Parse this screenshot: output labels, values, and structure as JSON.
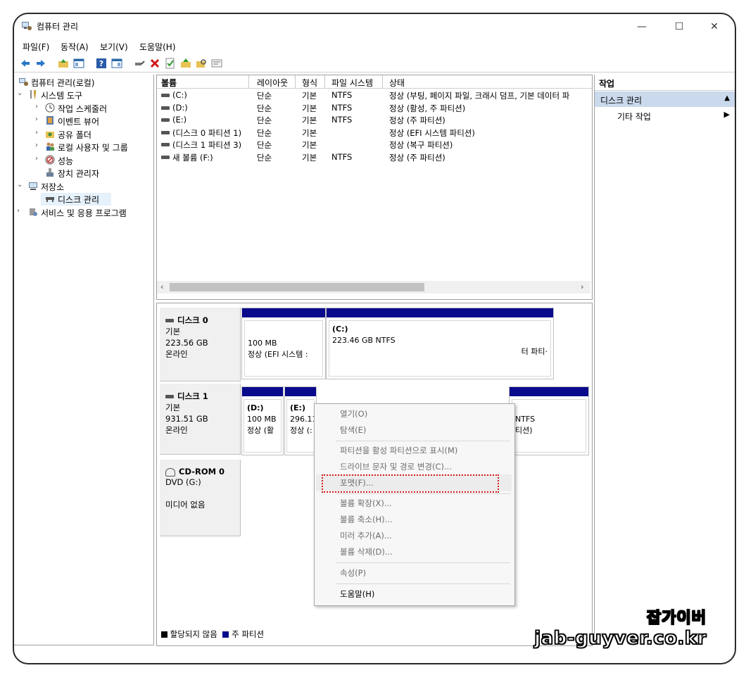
{
  "window": {
    "title": "컴퓨터 관리",
    "minimize": "—",
    "maximize": "☐",
    "close": "✕"
  },
  "menu": [
    "파일(F)",
    "동작(A)",
    "보기(V)",
    "도움말(H)"
  ],
  "tree": {
    "root": "컴퓨터 관리(로컬)",
    "system_tools": "시스템 도구",
    "task_scheduler": "작업 스케줄러",
    "event_viewer": "이벤트 뷰어",
    "shared_folders": "공유 폴더",
    "local_users": "로컬 사용자 및 그룹",
    "performance": "성능",
    "device_manager": "장치 관리자",
    "storage": "저장소",
    "disk_management": "디스크 관리",
    "services": "서비스 및 응용 프로그램"
  },
  "volume_table": {
    "headers": [
      "볼륨",
      "레이아웃",
      "형식",
      "파일 시스템",
      "상태"
    ],
    "rows": [
      [
        "(C:)",
        "단순",
        "기본",
        "NTFS",
        "정상 (부팅, 페이지 파일, 크래시 덤프, 기본 데이터 파"
      ],
      [
        "(D:)",
        "단순",
        "기본",
        "NTFS",
        "정상 (활성, 주 파티션)"
      ],
      [
        "(E:)",
        "단순",
        "기본",
        "NTFS",
        "정상 (주 파티션)"
      ],
      [
        "(디스크 0 파티션 1)",
        "단순",
        "기본",
        "",
        "정상 (EFI 시스템 파티션)"
      ],
      [
        "(디스크 1 파티션 3)",
        "단순",
        "기본",
        "",
        "정상 (복구 파티션)"
      ],
      [
        "새 볼륨 (F:)",
        "단순",
        "기본",
        "NTFS",
        "정상 (주 파티션)"
      ]
    ]
  },
  "disks": {
    "disk0": {
      "name": "디스크 0",
      "type": "기본",
      "size": "223.56 GB",
      "status": "온라인",
      "p1": {
        "size": "100 MB",
        "status": "정상 (EFI 시스템 :"
      },
      "p2": {
        "label": "(C:)",
        "size": "223.46 GB NTFS",
        "status": "터 파티·"
      }
    },
    "disk1": {
      "name": "디스크 1",
      "type": "기본",
      "size": "931.51 GB",
      "status": "온라인",
      "p1": {
        "label": "(D:)",
        "size": "100 MB",
        "status": "정상 (활"
      },
      "p2": {
        "label": "(E:)",
        "size": "296.11",
        "status": "정상 (:"
      },
      "p3": {
        "size": "NTFS",
        "status": "티션)"
      }
    },
    "cdrom": {
      "name": "CD-ROM 0",
      "type": "DVD (G:)",
      "status": "미디어 없음"
    }
  },
  "legend": {
    "unallocated": "할당되지 않음",
    "primary": "주 파티션"
  },
  "actions": {
    "header": "작업",
    "selected": "디스크 관리",
    "more": "기타 작업"
  },
  "context_menu": [
    "열기(O)",
    "탐색(E)",
    "파티션을 활성 파티션으로 표시(M)",
    "드라이브 문자 및 경로 변경(C)...",
    "포맷(F)...",
    "볼륨 확장(X)...",
    "볼륨 축소(H)...",
    "미러 추가(A)...",
    "볼륨 삭제(D)...",
    "속성(P)",
    "도움말(H)"
  ],
  "watermark": {
    "line1": "잡가이버",
    "line2": "jab-guyver.co.kr"
  },
  "colors": {
    "primary_partition": "#0a0a8c",
    "highlight_box": "#d61a1a",
    "action_selected": "#cad9ec"
  }
}
